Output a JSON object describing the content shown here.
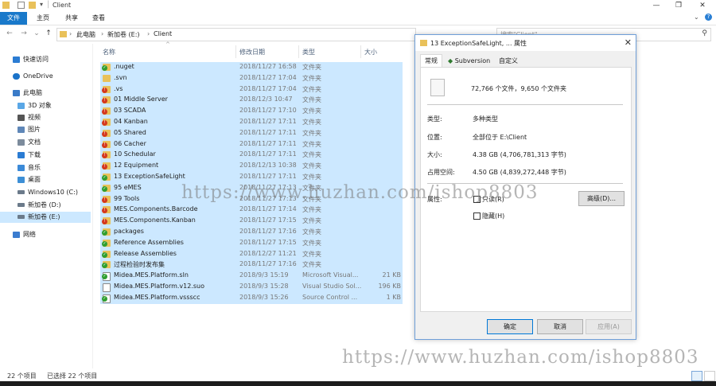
{
  "window": {
    "path_title": "Client"
  },
  "ribbon": {
    "tabs": [
      "文件",
      "主页",
      "共享",
      "查看"
    ]
  },
  "address": {
    "crumbs": [
      "此电脑",
      "新加卷 (E:)",
      "Client"
    ],
    "search_placeholder": "搜索\"Client\""
  },
  "sidebar": {
    "items": [
      {
        "label": "快速访问",
        "icon": "star-icon",
        "color": "#2b7cd3"
      },
      {
        "label": "OneDrive",
        "icon": "cloud-icon",
        "color": "#1a73c9"
      },
      {
        "label": "此电脑",
        "icon": "computer-icon",
        "color": "#3a7bc8"
      },
      {
        "label": "3D 对象",
        "icon": "cube-icon",
        "color": "#5aa7e6"
      },
      {
        "label": "视频",
        "icon": "video-icon",
        "color": "#555555"
      },
      {
        "label": "图片",
        "icon": "picture-icon",
        "color": "#5f87b8"
      },
      {
        "label": "文档",
        "icon": "document-icon",
        "color": "#7c8b9c"
      },
      {
        "label": "下载",
        "icon": "download-icon",
        "color": "#2b7cd3"
      },
      {
        "label": "音乐",
        "icon": "music-icon",
        "color": "#3b8ad8"
      },
      {
        "label": "桌面",
        "icon": "desktop-icon",
        "color": "#3d8fd6"
      },
      {
        "label": "Windows10 (C:)",
        "icon": "drive-icon",
        "color": "#6b7a8a"
      },
      {
        "label": "新加卷 (D:)",
        "icon": "drive-icon",
        "color": "#6b7a8a"
      },
      {
        "label": "新加卷 (E:)",
        "icon": "drive-icon",
        "color": "#6b7a8a"
      },
      {
        "label": "网络",
        "icon": "network-icon",
        "color": "#3b7ccf"
      }
    ]
  },
  "list": {
    "columns": [
      "名称",
      "修改日期",
      "类型",
      "大小"
    ],
    "rows": [
      {
        "name": ".nuget",
        "date": "2018/11/27 16:58",
        "type": "文件夹",
        "size": "",
        "badge": "ok",
        "kind": "folder"
      },
      {
        "name": ".svn",
        "date": "2018/11/27 17:04",
        "type": "文件夹",
        "size": "",
        "badge": "none",
        "kind": "folder"
      },
      {
        "name": ".vs",
        "date": "2018/11/27 17:04",
        "type": "文件夹",
        "size": "",
        "badge": "mod",
        "kind": "folder"
      },
      {
        "name": "01 Middle Server",
        "date": "2018/12/3 10:47",
        "type": "文件夹",
        "size": "",
        "badge": "mod",
        "kind": "folder"
      },
      {
        "name": "03 SCADA",
        "date": "2018/11/27 17:10",
        "type": "文件夹",
        "size": "",
        "badge": "mod",
        "kind": "folder"
      },
      {
        "name": "04 Kanban",
        "date": "2018/11/27 17:11",
        "type": "文件夹",
        "size": "",
        "badge": "mod",
        "kind": "folder"
      },
      {
        "name": "05 Shared",
        "date": "2018/11/27 17:11",
        "type": "文件夹",
        "size": "",
        "badge": "mod",
        "kind": "folder"
      },
      {
        "name": "06 Cacher",
        "date": "2018/11/27 17:11",
        "type": "文件夹",
        "size": "",
        "badge": "mod",
        "kind": "folder"
      },
      {
        "name": "10 Schedular",
        "date": "2018/11/27 17:11",
        "type": "文件夹",
        "size": "",
        "badge": "mod",
        "kind": "folder"
      },
      {
        "name": "12 Equipment",
        "date": "2018/12/13 10:38",
        "type": "文件夹",
        "size": "",
        "badge": "mod",
        "kind": "folder"
      },
      {
        "name": "13 ExceptionSafeLight",
        "date": "2018/11/27 17:11",
        "type": "文件夹",
        "size": "",
        "badge": "ok",
        "kind": "folder"
      },
      {
        "name": "95 eMES",
        "date": "2018/11/27 17:13",
        "type": "文件夹",
        "size": "",
        "badge": "ok",
        "kind": "folder"
      },
      {
        "name": "99 Tools",
        "date": "2018/11/27 17:13",
        "type": "文件夹",
        "size": "",
        "badge": "mod",
        "kind": "folder"
      },
      {
        "name": "MES.Components.Barcode",
        "date": "2018/11/27 17:14",
        "type": "文件夹",
        "size": "",
        "badge": "mod",
        "kind": "folder"
      },
      {
        "name": "MES.Components.Kanban",
        "date": "2018/11/27 17:15",
        "type": "文件夹",
        "size": "",
        "badge": "mod",
        "kind": "folder"
      },
      {
        "name": "packages",
        "date": "2018/11/27 17:16",
        "type": "文件夹",
        "size": "",
        "badge": "ok",
        "kind": "folder"
      },
      {
        "name": "Reference Assemblies",
        "date": "2018/11/27 17:15",
        "type": "文件夹",
        "size": "",
        "badge": "ok",
        "kind": "folder"
      },
      {
        "name": "Release Assemblies",
        "date": "2018/12/27 11:21",
        "type": "文件夹",
        "size": "",
        "badge": "ok",
        "kind": "folder"
      },
      {
        "name": "过程检验时发布集",
        "date": "2018/11/27 17:16",
        "type": "文件夹",
        "size": "",
        "badge": "ok",
        "kind": "folder"
      },
      {
        "name": "Midea.MES.Platform.sln",
        "date": "2018/9/3 15:19",
        "type": "Microsoft Visual...",
        "size": "21 KB",
        "badge": "ok",
        "kind": "sln"
      },
      {
        "name": "Midea.MES.Platform.v12.suo",
        "date": "2018/9/3 15:28",
        "type": "Visual Studio Sol...",
        "size": "196 KB",
        "badge": "none",
        "kind": "file"
      },
      {
        "name": "Midea.MES.Platform.vssscc",
        "date": "2018/9/3 15:26",
        "type": "Source Control ...",
        "size": "1 KB",
        "badge": "ok",
        "kind": "vss"
      }
    ]
  },
  "status": {
    "count": "22 个项目",
    "selected": "已选择 22 个项目"
  },
  "dialog": {
    "title": "13 ExceptionSafeLight, ... 属性",
    "tabs": [
      "常规",
      "Subversion",
      "自定义"
    ],
    "summary": "72,766 个文件，9,650 个文件夹",
    "type_label": "类型:",
    "type_value": "多种类型",
    "location_label": "位置:",
    "location_value": "全部位于 E:\\Client",
    "size_label": "大小:",
    "size_value": "4.38 GB (4,706,781,313 字节)",
    "disk_label": "占用空间:",
    "disk_value": "4.50 GB (4,839,272,448 字节)",
    "attr_label": "属性:",
    "readonly_label": "只读(R)",
    "hidden_label": "隐藏(H)",
    "advanced_button": "高级(D)...",
    "ok_button": "确定",
    "cancel_button": "取消",
    "apply_button": "应用(A)"
  },
  "watermark": {
    "text": "https://www.huzhan.com/ishop8803"
  }
}
